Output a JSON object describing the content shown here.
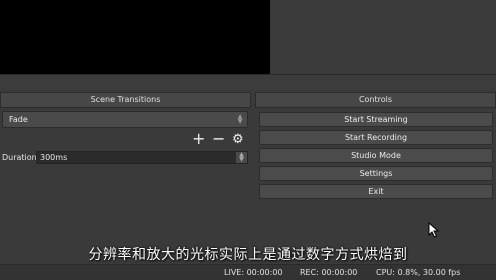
{
  "transitions": {
    "title": "Scene Transitions",
    "selected": "Fade",
    "add_icon": "plus-icon",
    "remove_icon": "minus-icon",
    "settings_icon": "gear-icon",
    "duration_label": "Duration",
    "duration_value": "300ms"
  },
  "controls": {
    "title": "Controls",
    "buttons": [
      "Start Streaming",
      "Start Recording",
      "Studio Mode",
      "Settings",
      "Exit"
    ]
  },
  "subtitle": "分辨率和放大的光标实际上是通过数字方式烘焙到",
  "status": {
    "live": "LIVE: 00:00:00",
    "rec": "REC: 00:00:00",
    "cpu": "CPU: 0.8%, 30.00 fps"
  }
}
